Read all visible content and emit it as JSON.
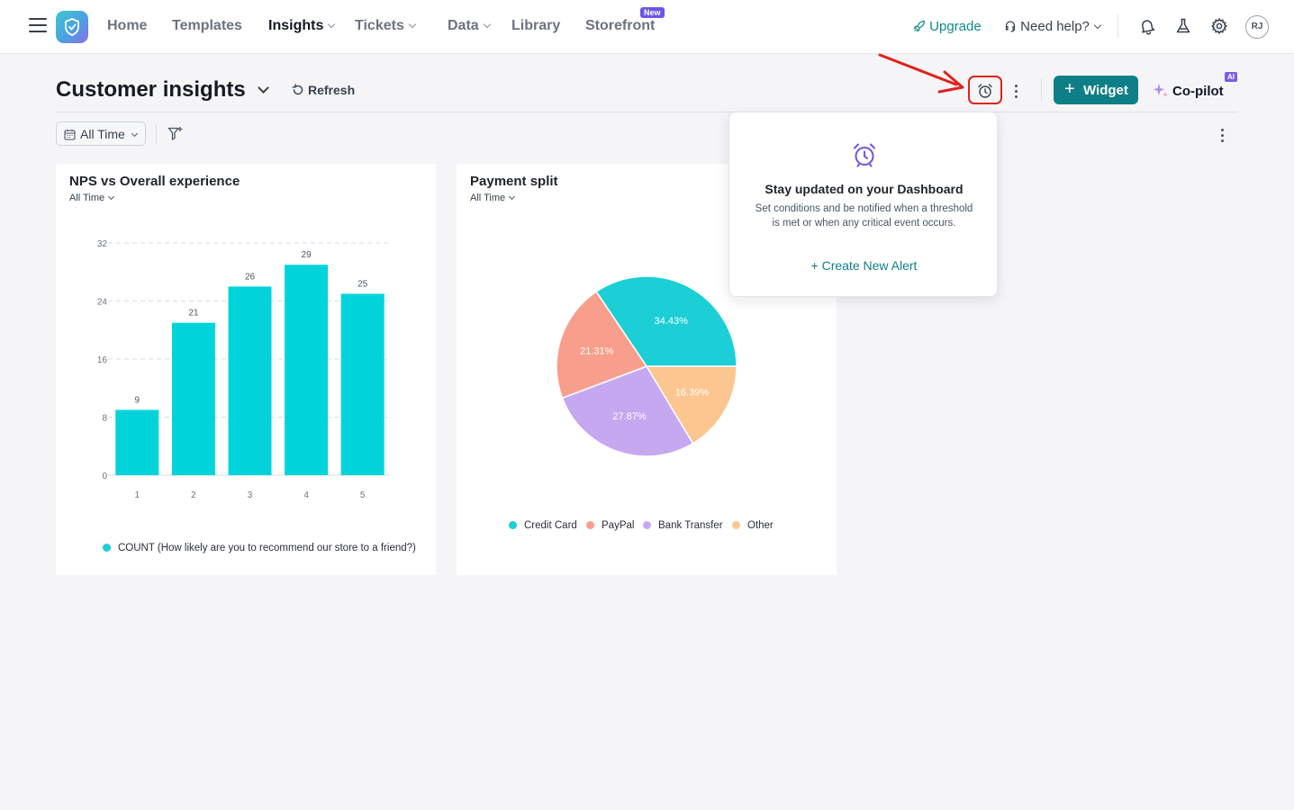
{
  "nav": {
    "items": [
      "Home",
      "Templates",
      "Insights",
      "Tickets",
      "Data",
      "Library",
      "Storefront"
    ],
    "new_badge": "New",
    "upgrade": "Upgrade",
    "need_help": "Need help?",
    "avatar": "RJ"
  },
  "header": {
    "title": "Customer insights",
    "refresh": "Refresh",
    "widget": "Widget",
    "copilot": "Co-pilot",
    "ai_badge": "AI"
  },
  "filter": {
    "time": "All Time"
  },
  "popover": {
    "title": "Stay updated on your Dashboard",
    "description": "Set conditions and be notified when a threshold is met or when any critical event occurs.",
    "link": "+ Create New Alert"
  },
  "colors": {
    "accent": "#0e7f86",
    "bar": "#00d4da",
    "credit_card": "#1ccfd6",
    "paypal": "#f79f8c",
    "bank_transfer": "#c6a8f0",
    "other": "#fcc690"
  },
  "chart_data": [
    {
      "type": "bar",
      "title": "NPS vs Overall experience",
      "subtitle": "All Time",
      "categories": [
        "1",
        "2",
        "3",
        "4",
        "5"
      ],
      "series": [
        {
          "name": "COUNT (How likely are you to recommend our store to a friend?)",
          "values": [
            9,
            21,
            26,
            29,
            25
          ]
        }
      ],
      "ylim": [
        0,
        32
      ],
      "yticks": [
        "0",
        "8",
        "16",
        "24",
        "32"
      ],
      "grid": true,
      "legend": "bottom"
    },
    {
      "type": "pie",
      "title": "Payment split",
      "subtitle": "All Time",
      "labels": [
        "Credit Card",
        "PayPal",
        "Bank Transfer",
        "Other"
      ],
      "values": [
        34.43,
        21.31,
        27.87,
        16.39
      ],
      "value_labels": [
        "34.43%",
        "21.31%",
        "27.87%",
        "16.39%"
      ],
      "legend": "bottom"
    }
  ]
}
